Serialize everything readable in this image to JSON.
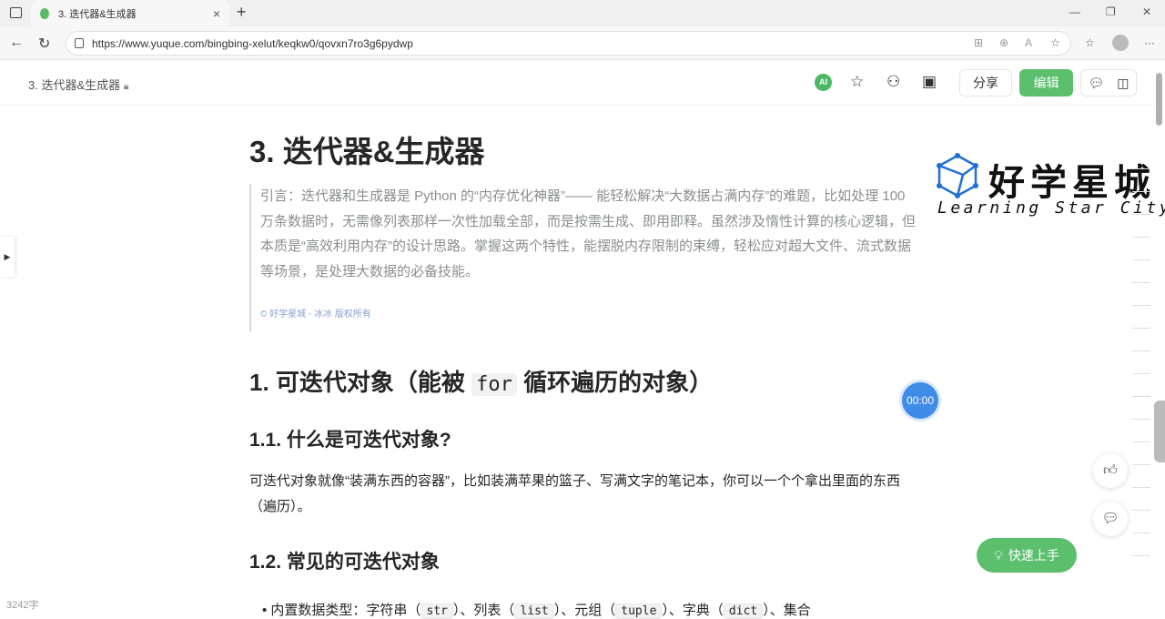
{
  "browser": {
    "tab_title": "3. 迭代器&生成器",
    "url": "https://www.yuque.com/bingbing-xelut/keqkw0/qovxn7ro3g6pydwp"
  },
  "header": {
    "breadcrumb": "3. 迭代器&生成器",
    "ai_label": "AI",
    "share_label": "分享",
    "edit_label": "编辑"
  },
  "doc": {
    "title": "3. 迭代器&生成器",
    "quote": "引言：迭代器和生成器是 Python 的“内存优化神器”—— 能轻松解决“大数据占满内存”的难题，比如处理 100 万条数据时，无需像列表那样一次性加载全部，而是按需生成、即用即释。虽然涉及惰性计算的核心逻辑，但本质是“高效利用内存”的设计思路。掌握这两个特性，能摆脱内存限制的束缚，轻松应对超大文件、流式数据等场景，是处理大数据的必备技能。",
    "copyright": "好学星城 - 冰冰 版权所有",
    "h2_prefix": "1. 可迭代对象（能被 ",
    "h2_code": "for",
    "h2_suffix": " 循环遍历的对象）",
    "h3_1": "1.1. 什么是可迭代对象?",
    "p1": "可迭代对象就像“装满东西的容器”，比如装满苹果的篮子、写满文字的笔记本，你可以一个个拿出里面的东西（遍历）。",
    "h3_2": "1.2. 常见的可迭代对象",
    "li": {
      "t1": "内置数据类型：字符串（",
      "c1": "str",
      "t2": "）、列表（",
      "c2": "list",
      "t3": "）、元组（",
      "c3": "tuple",
      "t4": "）、字典（",
      "c4": "dict",
      "t5": "）、集合"
    }
  },
  "logo": {
    "cn": "好学星城",
    "en": "Learning Star City"
  },
  "timer": "00:00",
  "quick_start": "快速上手",
  "word_count": "3242字"
}
